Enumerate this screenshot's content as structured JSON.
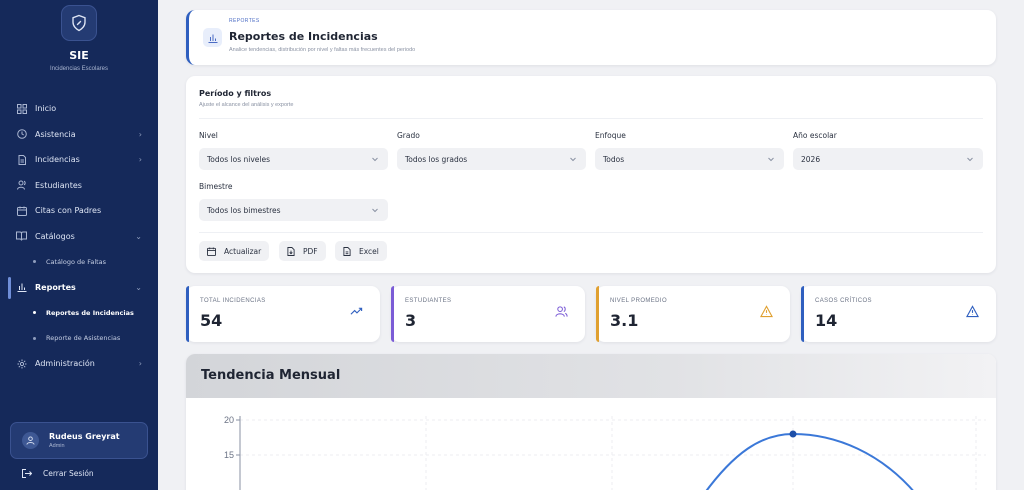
{
  "sidebar": {
    "brand": "SIE",
    "brand_sub": "Incidencias Escolares",
    "items": [
      {
        "label": "Inicio"
      },
      {
        "label": "Asistencia"
      },
      {
        "label": "Incidencias"
      },
      {
        "label": "Estudiantes"
      },
      {
        "label": "Citas con Padres"
      },
      {
        "label": "Catálogos"
      },
      {
        "label": "Catálogo de Faltas"
      },
      {
        "label": "Reportes"
      },
      {
        "label": "Reportes de Incidencias"
      },
      {
        "label": "Reporte de Asistencias"
      },
      {
        "label": "Administración"
      }
    ],
    "user": {
      "name": "Rudeus Greyrat",
      "role": "Admin"
    },
    "logout": "Cerrar Sesión"
  },
  "header": {
    "eyebrow": "REPORTES",
    "title": "Reportes de Incidencias",
    "subtitle": "Analice tendencias, distribución por nivel y faltas más frecuentes del periodo"
  },
  "filters": {
    "title": "Período y filtros",
    "subtitle": "Ajuste el alcance del análisis y exporte",
    "nivel": {
      "label": "Nivel",
      "value": "Todos los niveles"
    },
    "grado": {
      "label": "Grado",
      "value": "Todos los grados"
    },
    "enfoque": {
      "label": "Enfoque",
      "value": "Todos"
    },
    "anio": {
      "label": "Año escolar",
      "value": "2026"
    },
    "bimestre": {
      "label": "Bimestre",
      "value": "Todos los bimestres"
    },
    "buttons": {
      "refresh": "Actualizar",
      "pdf": "PDF",
      "excel": "Excel"
    }
  },
  "stats": [
    {
      "label": "TOTAL INCIDENCIAS",
      "value": "54",
      "color": "#2f5fbf",
      "icon": "trending-up-icon"
    },
    {
      "label": "ESTUDIANTES",
      "value": "3",
      "color": "#7b5cd6",
      "icon": "users-icon"
    },
    {
      "label": "NIVEL PROMEDIO",
      "value": "3.1",
      "color": "#e0a030",
      "icon": "warning-icon"
    },
    {
      "label": "CASOS CRÍTICOS",
      "value": "14",
      "color": "#2f5fbf",
      "icon": "alert-triangle-icon"
    }
  ],
  "chart": {
    "title": "Tendencia Mensual"
  },
  "chart_data": {
    "type": "line",
    "title": "Tendencia Mensual",
    "y_ticks": [
      "20",
      "15"
    ],
    "ylim": [
      0,
      20
    ],
    "peak_value": 18,
    "grid": true,
    "color": "#3b78d8"
  }
}
